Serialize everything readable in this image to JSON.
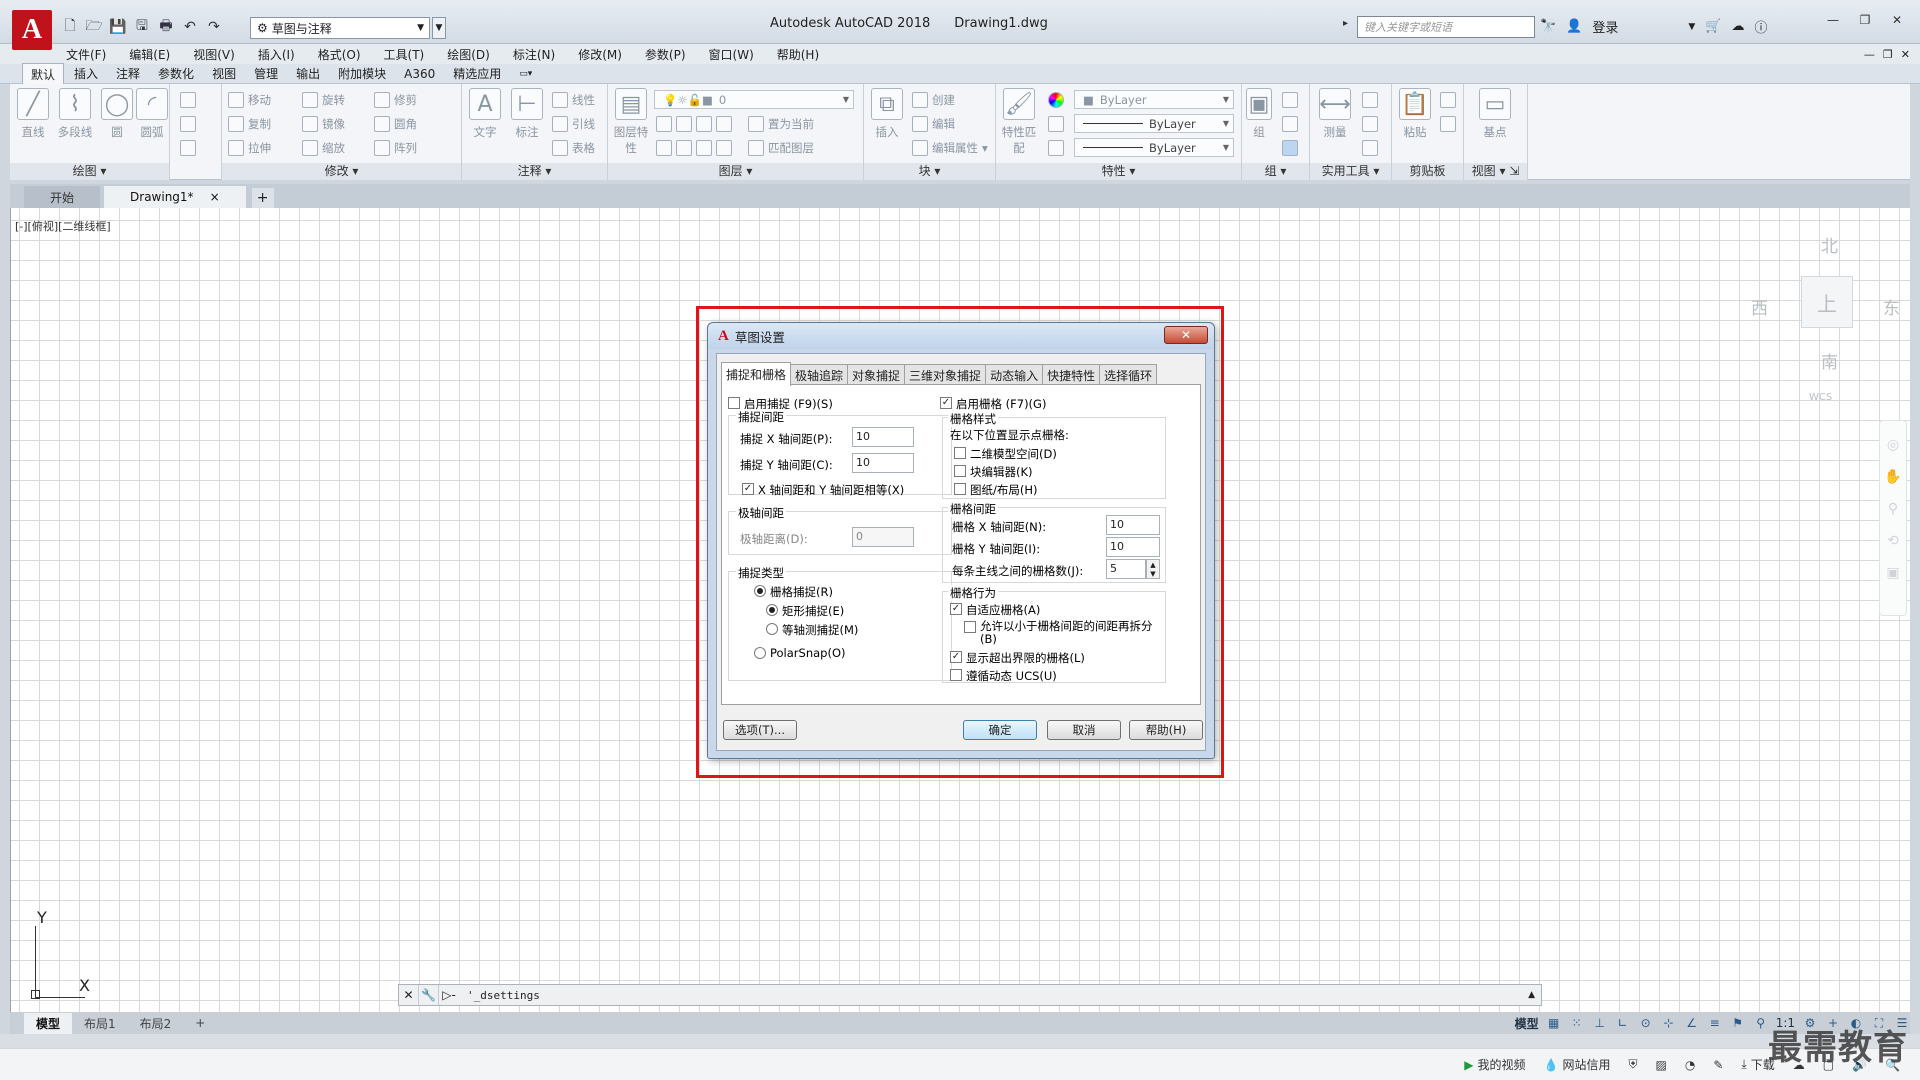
{
  "app": {
    "logo": "A",
    "title": "Autodesk AutoCAD 2018",
    "filename": "Drawing1.dwg",
    "workspace": "草图与注释",
    "search_placeholder": "键入关键字或短语",
    "login": "登录"
  },
  "menu": [
    "文件(F)",
    "编辑(E)",
    "视图(V)",
    "插入(I)",
    "格式(O)",
    "工具(T)",
    "绘图(D)",
    "标注(N)",
    "修改(M)",
    "参数(P)",
    "窗口(W)",
    "帮助(H)"
  ],
  "ribbon": {
    "tabs": [
      "默认",
      "插入",
      "注释",
      "参数化",
      "视图",
      "管理",
      "输出",
      "附加模块",
      "A360",
      "精选应用"
    ],
    "panels": {
      "draw": {
        "title": "绘图",
        "tools": [
          "直线",
          "多段线",
          "圆",
          "圆弧"
        ]
      },
      "modify": {
        "title": "修改",
        "tools": [
          "移动",
          "旋转",
          "修剪",
          "复制",
          "镜像",
          "圆角",
          "拉伸",
          "缩放",
          "阵列"
        ]
      },
      "annotation": {
        "title": "注释",
        "tools": [
          "文字",
          "标注",
          "线性",
          "引线",
          "表格"
        ]
      },
      "layers": {
        "title": "图层",
        "tools": [
          "图层特性",
          "置为当前",
          "匹配图层"
        ],
        "current_layer": "0"
      },
      "block": {
        "title": "块",
        "tools": [
          "插入",
          "创建",
          "编辑",
          "编辑属性"
        ]
      },
      "properties": {
        "title": "特性",
        "tools": [
          "特性匹配"
        ],
        "color": "ByLayer",
        "linetype": "ByLayer",
        "lineweight": "ByLayer"
      },
      "groups": {
        "title": "组",
        "tools": [
          "组"
        ]
      },
      "utilities": {
        "title": "实用工具",
        "tools": [
          "测量"
        ]
      },
      "clipboard": {
        "title": "剪贴板",
        "tools": [
          "粘贴"
        ]
      },
      "view": {
        "title": "视图",
        "tools": [
          "基点"
        ]
      }
    }
  },
  "file_tabs": [
    {
      "label": "开始"
    },
    {
      "label": "Drawing1*",
      "close": "×"
    }
  ],
  "file_tab_add": "+",
  "viewport_label": "[-][俯视][二维线框]",
  "viewcube": {
    "north": "北",
    "south": "南",
    "east": "东",
    "west": "西",
    "face": "上",
    "wcs": "WCS"
  },
  "ucs": {
    "x": "X",
    "y": "Y"
  },
  "command_line": {
    "text": "'_dsettings",
    "prompt": "▷-"
  },
  "layout_tabs": [
    "模型",
    "布局1",
    "布局2"
  ],
  "layout_tab_add": "+",
  "status": {
    "model": "模型",
    "scale": "1:1"
  },
  "taskbar": {
    "video": "我的视频",
    "credit": "网站信用",
    "download": "下载"
  },
  "watermark": "最需教育",
  "dialog": {
    "title": "草图设置",
    "close": "✕",
    "tabs": [
      "捕捉和栅格",
      "极轴追踪",
      "对象捕捉",
      "三维对象捕捉",
      "动态输入",
      "快捷特性",
      "选择循环"
    ],
    "snap_on": {
      "label": "启用捕捉 (F9)(S)",
      "checked": false
    },
    "grid_on": {
      "label": "启用栅格 (F7)(G)",
      "checked": true
    },
    "snap_spacing": {
      "title": "捕捉间距",
      "x_label": "捕捉 X 轴间距(P):",
      "x_value": "10",
      "y_label": "捕捉 Y 轴间距(C):",
      "y_value": "10",
      "equal_label": "X 轴间距和 Y 轴间距相等(X)",
      "equal_checked": true
    },
    "polar_spacing": {
      "title": "极轴间距",
      "label": "极轴距离(D):",
      "value": "0"
    },
    "snap_type": {
      "title": "捕捉类型",
      "grid_snap": "栅格捕捉(R)",
      "rect_snap": "矩形捕捉(E)",
      "iso_snap": "等轴测捕捉(M)",
      "polar_snap": "PolarSnap(O)"
    },
    "grid_style": {
      "title": "栅格样式",
      "subtitle": "在以下位置显示点栅格:",
      "model_2d": "二维模型空间(D)",
      "block_editor": "块编辑器(K)",
      "sheet_layout": "图纸/布局(H)"
    },
    "grid_spacing": {
      "title": "栅格间距",
      "x_label": "栅格 X 轴间距(N):",
      "x_value": "10",
      "y_label": "栅格 Y 轴间距(I):",
      "y_value": "10",
      "major_label": "每条主线之间的栅格数(J):",
      "major_value": "5"
    },
    "grid_behavior": {
      "title": "栅格行为",
      "adaptive": "自适应栅格(A)",
      "subdivide": "允许以小于栅格间距的间距再拆分(B)",
      "beyond_limits": "显示超出界限的栅格(L)",
      "follow_ucs": "遵循动态 UCS(U)"
    },
    "buttons": {
      "options": "选项(T)...",
      "ok": "确定",
      "cancel": "取消",
      "help": "帮助(H)"
    }
  }
}
